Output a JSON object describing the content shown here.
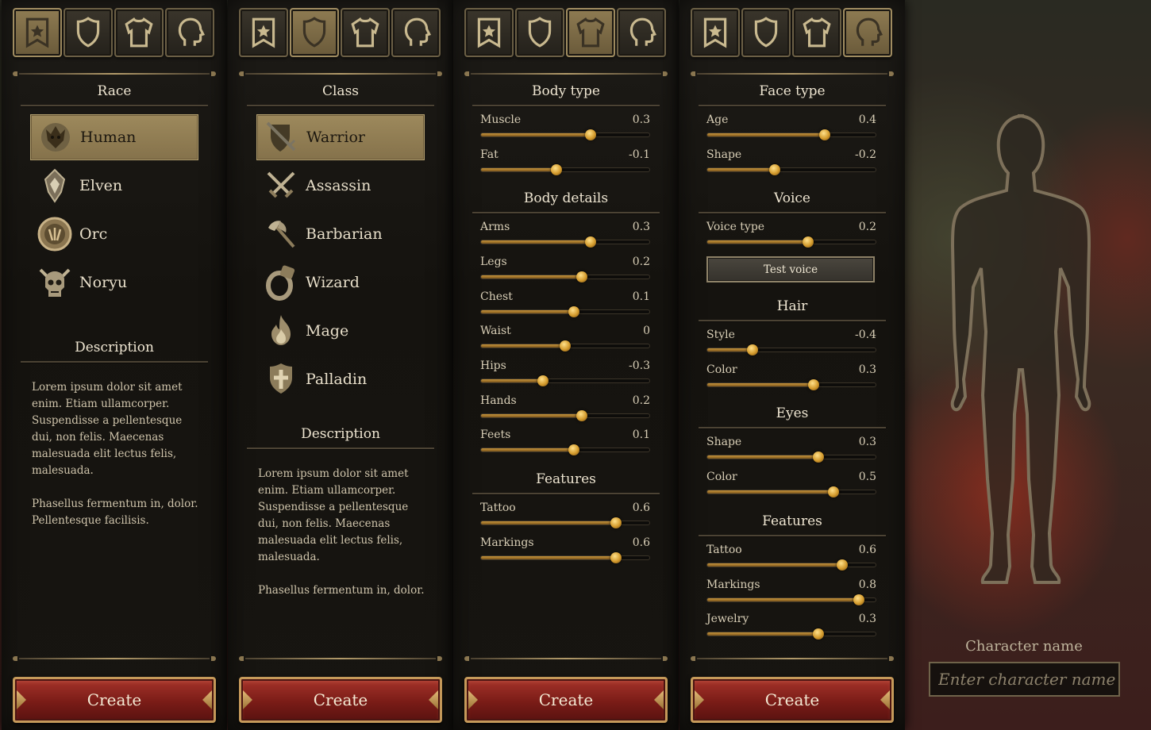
{
  "tabs": [
    {
      "icon": "star-banner-icon"
    },
    {
      "icon": "shield-icon"
    },
    {
      "icon": "torso-icon"
    },
    {
      "icon": "head-profile-icon"
    }
  ],
  "race_panel": {
    "active_tab": 0,
    "heading": "Race",
    "items": [
      {
        "label": "Human",
        "icon": "lion-head-icon",
        "selected": true
      },
      {
        "label": "Elven",
        "icon": "elven-emblem-icon",
        "selected": false
      },
      {
        "label": "Orc",
        "icon": "orc-medallion-icon",
        "selected": false
      },
      {
        "label": "Noryu",
        "icon": "horned-skull-icon",
        "selected": false
      }
    ],
    "description_heading": "Description",
    "description": "Lorem ipsum dolor sit amet enim. Etiam ullamcorper. Suspendisse a pellentesque dui, non felis. Maecenas malesuada elit lectus felis, malesuada.\n\nPhasellus fermentum in, dolor. Pellentesque facilisis.",
    "create_label": "Create"
  },
  "class_panel": {
    "active_tab": 1,
    "heading": "Class",
    "items": [
      {
        "label": "Warrior",
        "icon": "sword-shield-icon",
        "selected": true
      },
      {
        "label": "Assassin",
        "icon": "crossed-daggers-icon",
        "selected": false
      },
      {
        "label": "Barbarian",
        "icon": "battle-axe-icon",
        "selected": false
      },
      {
        "label": "Wizard",
        "icon": "ring-icon",
        "selected": false
      },
      {
        "label": "Mage",
        "icon": "flame-icon",
        "selected": false
      },
      {
        "label": "Palladin",
        "icon": "cross-shield-icon",
        "selected": false
      }
    ],
    "description_heading": "Description",
    "description": "Lorem ipsum dolor sit amet enim. Etiam ullamcorper. Suspendisse a pellentesque dui, non felis. Maecenas malesuada elit lectus felis, malesuada.\n\nPhasellus fermentum in, dolor.",
    "create_label": "Create"
  },
  "body_panel": {
    "active_tab": 2,
    "sections": [
      {
        "heading": "Body type",
        "sliders": [
          {
            "label": "Muscle",
            "value": "0.3",
            "level": 0.65
          },
          {
            "label": "Fat",
            "value": "-0.1",
            "level": 0.45
          }
        ]
      },
      {
        "heading": "Body details",
        "sliders": [
          {
            "label": "Arms",
            "value": "0.3",
            "level": 0.65
          },
          {
            "label": "Legs",
            "value": "0.2",
            "level": 0.6
          },
          {
            "label": "Chest",
            "value": "0.1",
            "level": 0.55
          },
          {
            "label": "Waist",
            "value": "0",
            "level": 0.5
          },
          {
            "label": "Hips",
            "value": "-0.3",
            "level": 0.37
          },
          {
            "label": "Hands",
            "value": "0.2",
            "level": 0.6
          },
          {
            "label": "Feets",
            "value": "0.1",
            "level": 0.55
          }
        ]
      },
      {
        "heading": "Features",
        "sliders": [
          {
            "label": "Tattoo",
            "value": "0.6",
            "level": 0.8
          },
          {
            "label": "Markings",
            "value": "0.6",
            "level": 0.8
          }
        ]
      }
    ],
    "create_label": "Create"
  },
  "face_panel": {
    "active_tab": 3,
    "sections": [
      {
        "heading": "Face type",
        "sliders": [
          {
            "label": "Age",
            "value": "0.4",
            "level": 0.7
          },
          {
            "label": "Shape",
            "value": "-0.2",
            "level": 0.4
          }
        ]
      },
      {
        "heading": "Voice",
        "sliders": [
          {
            "label": "Voice type",
            "value": "0.2",
            "level": 0.6
          }
        ],
        "button": "Test voice"
      },
      {
        "heading": "Hair",
        "sliders": [
          {
            "label": "Style",
            "value": "-0.4",
            "level": 0.27
          },
          {
            "label": "Color",
            "value": "0.3",
            "level": 0.63
          }
        ]
      },
      {
        "heading": "Eyes",
        "sliders": [
          {
            "label": "Shape",
            "value": "0.3",
            "level": 0.66
          },
          {
            "label": "Color",
            "value": "0.5",
            "level": 0.75
          }
        ]
      },
      {
        "heading": "Features",
        "sliders": [
          {
            "label": "Tattoo",
            "value": "0.6",
            "level": 0.8
          },
          {
            "label": "Markings",
            "value": "0.8",
            "level": 0.9
          },
          {
            "label": "Jewelry",
            "value": "0.3",
            "level": 0.66
          }
        ]
      }
    ],
    "create_label": "Create"
  },
  "preview": {
    "name_label": "Character name",
    "name_placeholder": "Enter character name",
    "name_value": ""
  },
  "colors": {
    "accent_gold": "#9d895c",
    "button_red": "#8a221c",
    "panel_bg": "#17150f"
  }
}
